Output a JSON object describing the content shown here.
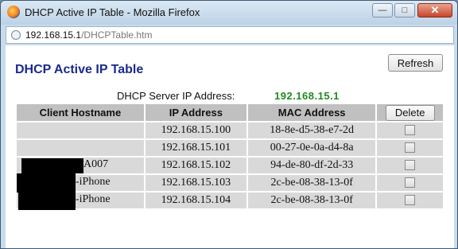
{
  "window": {
    "title": "DHCP Active IP Table - Mozilla Firefox",
    "minimize_label": "—",
    "maximize_label": "□",
    "close_label": "✕"
  },
  "address_bar": {
    "host": "192.168.15.1",
    "path": "/DHCPTable.htm"
  },
  "page": {
    "title": "DHCP Active IP Table",
    "refresh_label": "Refresh",
    "server_label": "DHCP Server IP Address:",
    "server_ip": "192.168.15.1",
    "table": {
      "headers": {
        "hostname": "Client Hostname",
        "ip": "IP Address",
        "mac": "MAC Address",
        "delete": "Delete"
      },
      "rows": [
        {
          "hostname": "",
          "ip": "192.168.15.100",
          "mac": "18-8e-d5-38-e7-2d"
        },
        {
          "hostname": "",
          "ip": "192.168.15.101",
          "mac": "00-27-0e-0a-d4-8a"
        },
        {
          "hostname": "A007",
          "ip": "192.168.15.102",
          "mac": "94-de-80-df-2d-33"
        },
        {
          "hostname": "-iPhone",
          "ip": "192.168.15.103",
          "mac": "2c-be-08-38-13-0f"
        },
        {
          "hostname": "-iPhone",
          "ip": "192.168.15.104",
          "mac": "2c-be-08-38-13-0f"
        }
      ]
    }
  },
  "colors": {
    "title_blue": "#1b2a8c",
    "server_ip_green": "#1f8a1f",
    "header_gray": "#c0c0c0",
    "cell_gray": "#d9d9d9"
  }
}
